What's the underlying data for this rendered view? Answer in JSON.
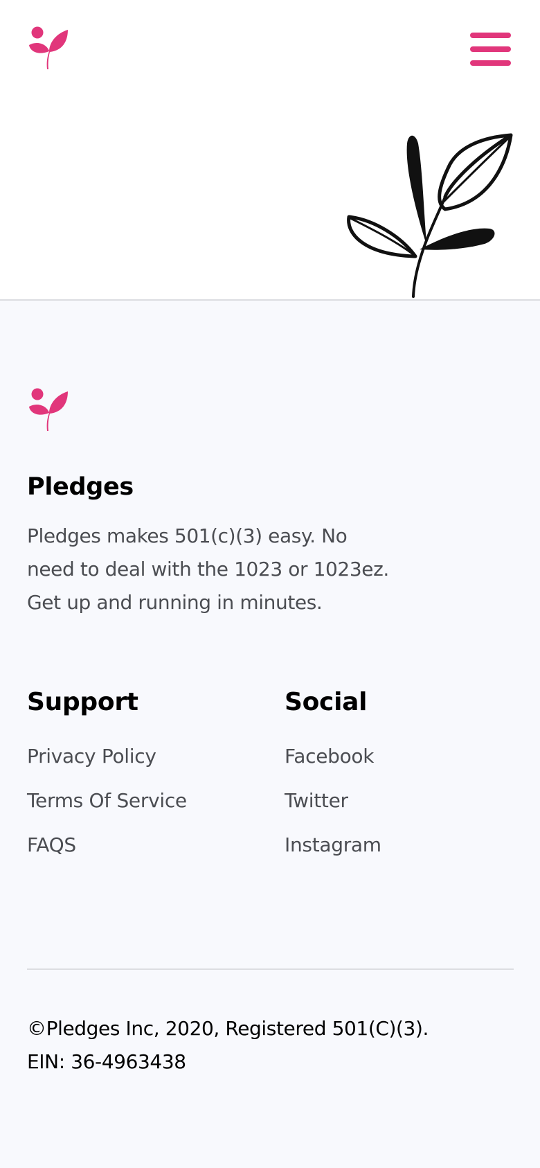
{
  "header": {
    "logo_icon": "sprout-icon",
    "menu_icon": "hamburger-menu-icon",
    "illustration": "leaf-branch-illustration"
  },
  "colors": {
    "brand": "#e1367b",
    "footer_background": "#f8f9fd",
    "body_text": "#4b4d52",
    "divider": "#dcdde1"
  },
  "footer": {
    "logo_icon": "sprout-icon",
    "brand_title": "Pledges",
    "brand_description_lines": [
      "Pledges makes 501(c)(3) easy. No",
      "need to deal with the 1023 or 1023ez.",
      "Get up and running in minutes."
    ],
    "support": {
      "heading": "Support",
      "links": [
        "Privacy Policy",
        "Terms Of Service",
        "FAQS"
      ]
    },
    "social": {
      "heading": "Social",
      "links": [
        "Facebook",
        "Twitter",
        "Instagram"
      ]
    },
    "copyright_lines": [
      "©Pledges Inc, 2020, Registered 501(C)(3).",
      "EIN: 36-4963438"
    ]
  }
}
